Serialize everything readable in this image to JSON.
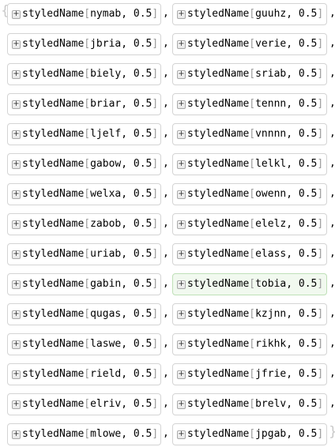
{
  "list": {
    "open_brace": "{",
    "close_brace": "}",
    "separator": ",",
    "function_name": "styledName",
    "bracket_open": "[",
    "bracket_close": "]",
    "arg_separator": ", ",
    "value": "0.5",
    "plus_glyph": "+",
    "highlight_color": "#f1f9ef",
    "rows": [
      [
        "nymab",
        "guuhz"
      ],
      [
        "jbria",
        "verie"
      ],
      [
        "biely",
        "sriab"
      ],
      [
        "briar",
        "tennn"
      ],
      [
        "ljelf",
        "vnnnn"
      ],
      [
        "gabow",
        "lelkl"
      ],
      [
        "welxa",
        "owenn"
      ],
      [
        "zabob",
        "elelz"
      ],
      [
        "uriab",
        "elass"
      ],
      [
        "gabin",
        "tobia"
      ],
      [
        "qugas",
        "kzjnn"
      ],
      [
        "laswe",
        "rikhk"
      ],
      [
        "rield",
        "jfrie"
      ],
      [
        "elriv",
        "brelv"
      ],
      [
        "mlowe",
        "jpgab"
      ]
    ],
    "highlighted": {
      "row": 9,
      "col": 1
    }
  }
}
